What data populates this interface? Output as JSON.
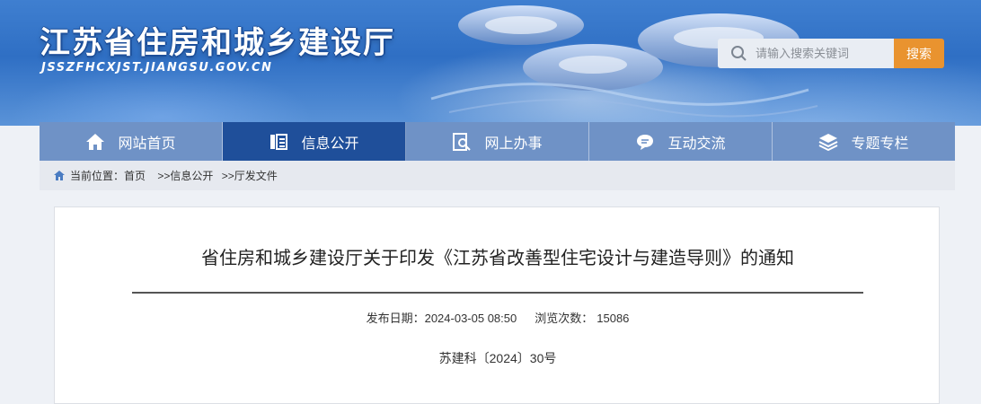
{
  "header": {
    "title": "江苏省住房和城乡建设厅",
    "domain": "JSSZFHCXJST.JIANGSU.GOV.CN"
  },
  "search": {
    "placeholder": "请输入搜索关键词",
    "button_label": "搜索"
  },
  "nav": {
    "items": [
      {
        "label": "网站首页",
        "icon": "home-icon"
      },
      {
        "label": "信息公开",
        "icon": "document-list-icon"
      },
      {
        "label": "网上办事",
        "icon": "search-document-icon"
      },
      {
        "label": "互动交流",
        "icon": "chat-bubble-icon"
      },
      {
        "label": "专题专栏",
        "icon": "layers-icon"
      }
    ],
    "active": "信息公开"
  },
  "breadcrumb": {
    "prefix": "当前位置：",
    "items": [
      "首页",
      " >>信息公开",
      " >>厅发文件"
    ]
  },
  "article": {
    "title": "省住房和城乡建设厅关于印发《江苏省改善型住宅设计与建造导则》的通知",
    "date_label": "发布日期：",
    "date": "2024-03-05 08:50",
    "views_label": "浏览次数：",
    "views": "15086",
    "doc_number": "苏建科〔2024〕30号"
  },
  "colors": {
    "nav_active": "#1f4f9a",
    "nav_bg": "#6f92c6",
    "search_button": "#e9932f"
  }
}
